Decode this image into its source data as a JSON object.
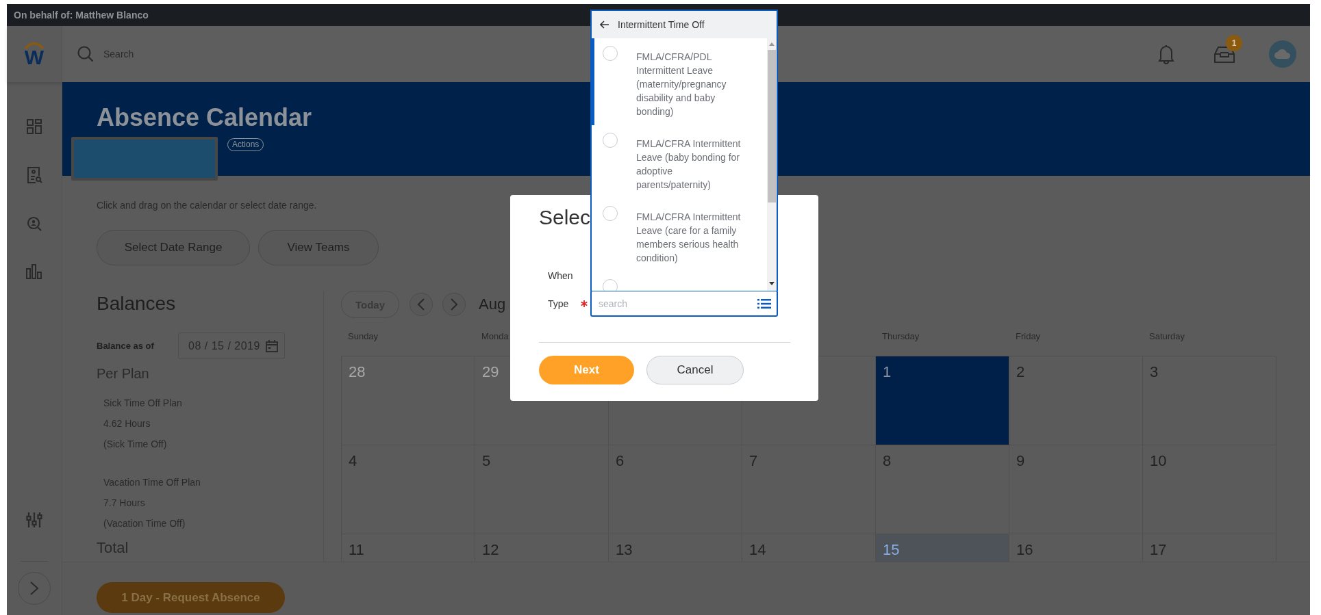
{
  "top_bar": {
    "text": "On behalf of: Matthew Blanco"
  },
  "logo": {
    "letter": "W"
  },
  "search": {
    "placeholder": "Search"
  },
  "inbox": {
    "badge": "1"
  },
  "page": {
    "title": "Absence Calendar",
    "actions": "Actions",
    "instruction": "Click and drag on the calendar or select date range.",
    "buttons": [
      "Select Date Range",
      "View Teams"
    ]
  },
  "balances": {
    "title": "Balances",
    "as_of_label": "Balance as of",
    "date": "08 / 15 / 2019",
    "per_plan": "Per Plan",
    "plans": [
      {
        "name": "Sick Time Off Plan",
        "amount": "4.62 Hours",
        "type": "(Sick Time Off)"
      },
      {
        "name": "Vacation Time Off Plan",
        "amount": "7.7 Hours",
        "type": "(Vacation Time Off)"
      }
    ],
    "total": "Total"
  },
  "calendar": {
    "today_button": "Today",
    "month": "Aug",
    "weekdays": [
      {
        "label": "Sunday"
      },
      {
        "label": "Monda"
      },
      {
        "label": "Thursday"
      },
      {
        "label": "Friday"
      },
      {
        "label": "Saturday"
      }
    ],
    "weeks": [
      [
        {
          "day": "28",
          "outside_month": true,
          "selected": false,
          "today": false
        },
        {
          "day": "29",
          "outside_month": true,
          "selected": false,
          "today": false
        },
        {
          "selected": false,
          "today": false
        },
        {
          "selected": false,
          "today": false
        },
        {
          "day": "1",
          "outside_month": false,
          "selected": true,
          "today": false
        },
        {
          "day": "2",
          "outside_month": false,
          "selected": false,
          "today": false
        },
        {
          "day": "3",
          "outside_month": false,
          "selected": false,
          "today": false
        }
      ],
      [
        {
          "day": "4",
          "outside_month": false,
          "selected": false,
          "today": false
        },
        {
          "day": "5",
          "outside_month": false,
          "selected": false,
          "today": false
        },
        {
          "day": "6",
          "outside_month": false,
          "selected": false,
          "today": false
        },
        {
          "day": "7",
          "outside_month": false,
          "selected": false,
          "today": false
        },
        {
          "day": "8",
          "outside_month": false,
          "selected": false,
          "today": false
        },
        {
          "day": "9",
          "outside_month": false,
          "selected": false,
          "today": false
        },
        {
          "day": "10",
          "outside_month": false,
          "selected": false,
          "today": false
        }
      ],
      [
        {
          "day": "11",
          "outside_month": false,
          "selected": false,
          "today": false
        },
        {
          "day": "12",
          "outside_month": false,
          "selected": false,
          "today": false
        },
        {
          "day": "13",
          "outside_month": false,
          "selected": false,
          "today": false
        },
        {
          "day": "14",
          "outside_month": false,
          "selected": false,
          "today": false
        },
        {
          "day": "15",
          "outside_month": false,
          "selected": false,
          "today": true
        },
        {
          "day": "16",
          "outside_month": false,
          "selected": false,
          "today": false
        },
        {
          "day": "17",
          "outside_month": false,
          "selected": false,
          "today": false
        }
      ]
    ]
  },
  "request_button": "1 Day - Request Absence",
  "dialog": {
    "title": "Selec",
    "fields": [
      {
        "label": "When",
        "required": false
      },
      {
        "label": "Type",
        "required": true
      }
    ],
    "search_placeholder": "search",
    "buttons": [
      {
        "label": "Next",
        "kind": "primary"
      },
      {
        "label": "Cancel",
        "kind": "secondary"
      }
    ]
  },
  "dropdown": {
    "title": "Intermittent Time Off",
    "options": [
      {
        "label": "FMLA/CFRA/PDL Intermittent Leave (maternity/pregnancy disability and baby bonding)",
        "focused": true
      },
      {
        "label": "FMLA/CFRA Intermittent Leave (baby bonding for adoptive parents/paternity)",
        "focused": false
      },
      {
        "label": "FMLA/CFRA Intermittent Leave (care for a family members serious health condition)",
        "focused": false
      },
      {
        "focused": false
      }
    ]
  }
}
